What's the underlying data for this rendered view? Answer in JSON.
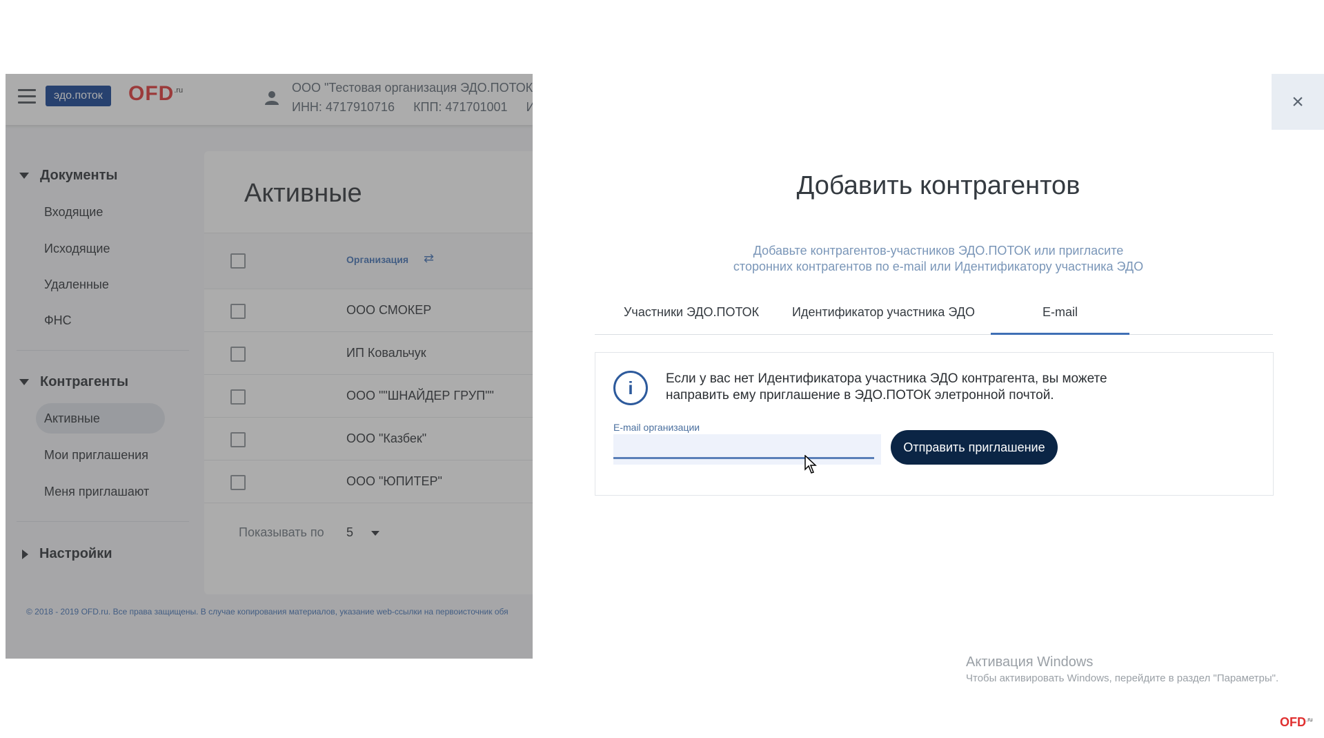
{
  "app": {
    "badge": "эдо.поток",
    "logo": "OFD",
    "logo_suffix": ".ru",
    "org_name": "ООО \"Тестовая организация ЭДО.ПОТОК\"",
    "inn": "ИНН: 4717910716",
    "kpp": "КПП: 471701001",
    "id_partial": "Ид"
  },
  "sidebar": {
    "documents": "Документы",
    "doc_items": [
      "Входящие",
      "Исходящие",
      "Удаленные",
      "ФНС"
    ],
    "contractors": "Контрагенты",
    "contractor_items": [
      "Активные",
      "Мои приглашения",
      "Меня приглашают"
    ],
    "settings": "Настройки"
  },
  "content": {
    "title": "Активные",
    "column_org": "Организация",
    "rows": [
      "ООО СМОКЕР",
      "ИП Ковальчук",
      "ООО \"\"ШНАЙДЕР ГРУП\"\"",
      "ООО \"Казбек\"",
      "ООО \"ЮПИТЕР\""
    ],
    "pager_label": "Показывать по",
    "pager_value": "5",
    "copyright": "© 2018 - 2019 OFD.ru. Все права защищены. В случае копирования материалов, указание web-ссылки на первоисточник обя"
  },
  "modal": {
    "close": "×",
    "title": "Добавить контрагентов",
    "subtitle_line1": "Добавьте контрагентов-участников ЭДО.ПОТОК или пригласите",
    "subtitle_line2": "сторонних контрагентов по e-mail или Идентификатору участника ЭДО",
    "tabs": [
      "Участники ЭДО.ПОТОК",
      "Идентификатор участника ЭДО",
      "E-mail"
    ],
    "active_tab": "E-mail",
    "info_line1": "Если у вас нет Идентификатора участника ЭДО контрагента, вы можете",
    "info_line2": "направить ему приглашение в ЭДО.ПОТОК элетронной почтой.",
    "email_label": "E-mail организации",
    "email_value": "",
    "send_button": "Отправить приглашение"
  },
  "watermark": {
    "title": "Активация Windows",
    "subtitle": "Чтобы активировать Windows, перейдите в раздел \"Параметры\".",
    "corner_logo": "OFD",
    "corner_suffix": ".ru"
  },
  "colors": {
    "brand_blue": "#0e3d91",
    "brand_red": "#e03030",
    "button_dark": "#0b2545",
    "tab_underline": "#3f6fb5"
  }
}
